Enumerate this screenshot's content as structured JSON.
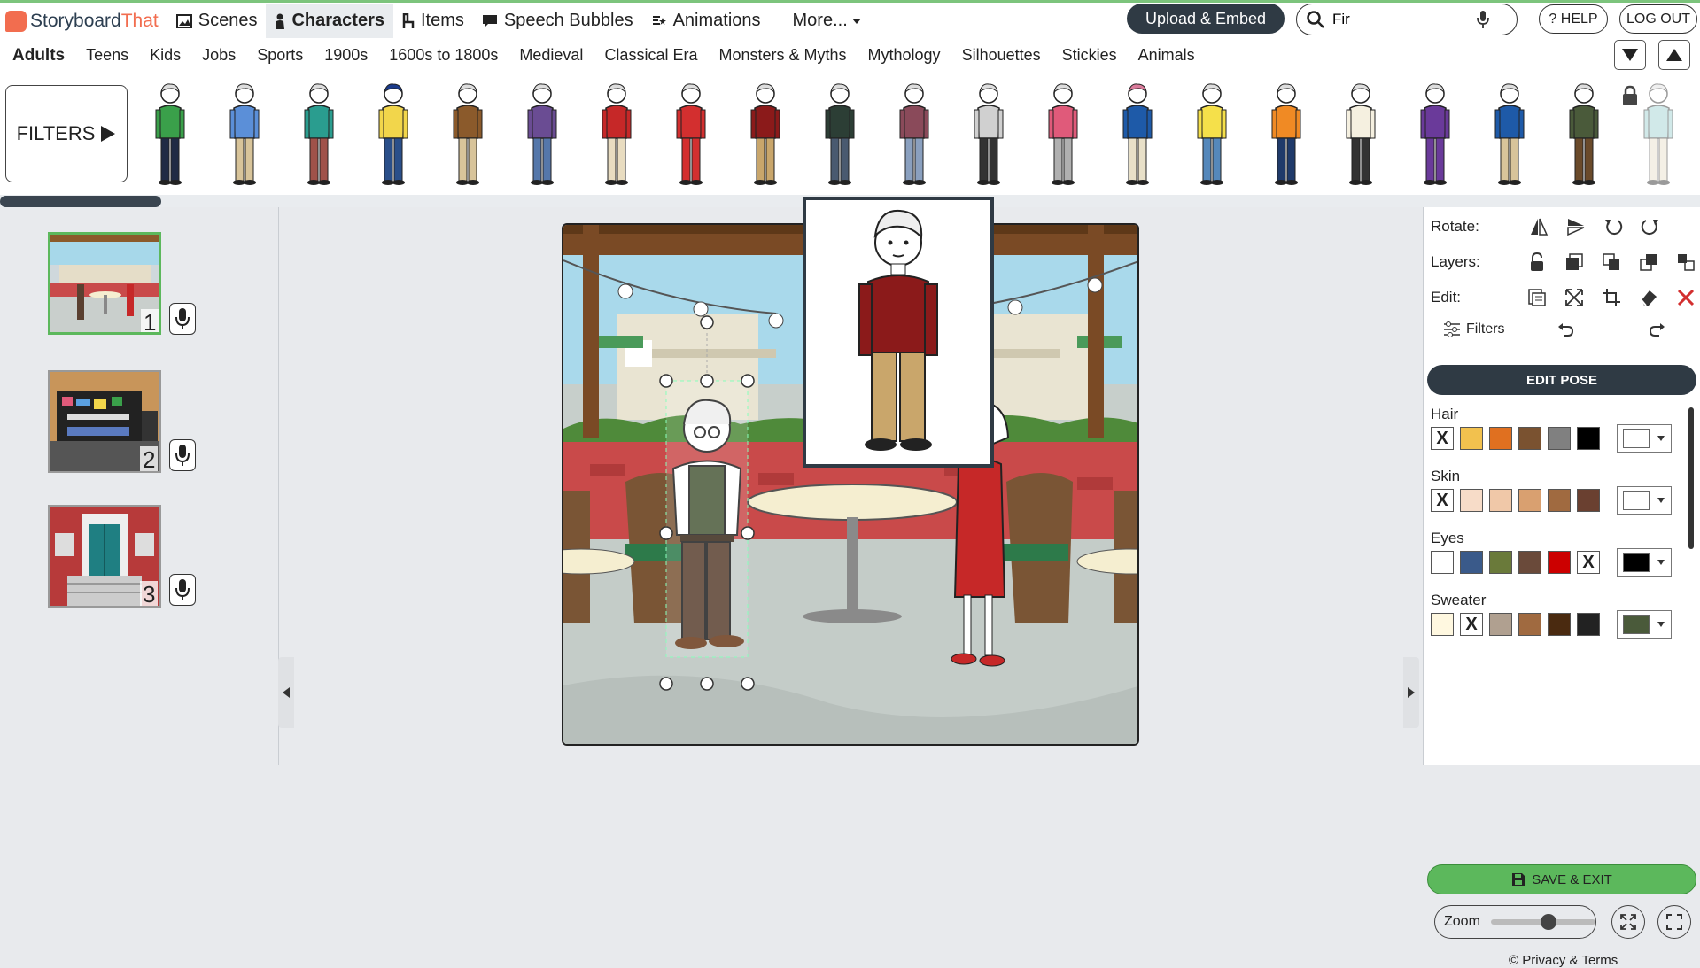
{
  "app": {
    "logo_part1": "Storyboard",
    "logo_part2": "That"
  },
  "nav": {
    "tabs": [
      {
        "label": "Scenes",
        "icon": "image-icon"
      },
      {
        "label": "Characters",
        "icon": "person-icon",
        "active": true
      },
      {
        "label": "Items",
        "icon": "chair-icon"
      },
      {
        "label": "Speech Bubbles",
        "icon": "speech-bubble-icon"
      },
      {
        "label": "Animations",
        "icon": "animations-icon"
      },
      {
        "label": "More...",
        "icon": "chevron-down-icon"
      }
    ],
    "upload_label": "Upload & Embed",
    "search_value": "Fir",
    "help_label": "? HELP",
    "logout_label": "LOG OUT"
  },
  "categories": [
    "Adults",
    "Teens",
    "Kids",
    "Jobs",
    "Sports",
    "1900s",
    "1600s to 1800s",
    "Medieval",
    "Classical Era",
    "Monsters & Myths",
    "Mythology",
    "Silhouettes",
    "Stickies",
    "Animals"
  ],
  "filters_label": "FILTERS",
  "characters": [
    {
      "shirt": "#3aa04a",
      "pants": "#1f2a44",
      "hair": "#ddd"
    },
    {
      "shirt": "#5b8fd8",
      "pants": "#d8c49a",
      "hair": "#ddd"
    },
    {
      "shirt": "#2a9d8f",
      "pants": "#a0524a",
      "hair": "#ddd"
    },
    {
      "shirt": "#f2d64b",
      "pants": "#2a4f8a",
      "hair": "#1a3a8a"
    },
    {
      "shirt": "#8b5a2b",
      "pants": "#d8c49a",
      "hair": "#ddd"
    },
    {
      "shirt": "#6a4c93",
      "pants": "#5577aa",
      "hair": "#ddd"
    },
    {
      "shirt": "#c62828",
      "pants": "#e8dcc0",
      "hair": "#ddd"
    },
    {
      "shirt": "#d32f2f",
      "pants": "#d32f2f",
      "hair": "#ddd"
    },
    {
      "shirt": "#8b1a1a",
      "pants": "#c9a66b",
      "hair": "#ddd"
    },
    {
      "shirt": "#2c3e35",
      "pants": "#4a5a70",
      "hair": "#ddd"
    },
    {
      "shirt": "#8a4a5a",
      "pants": "#8aa0bf",
      "hair": "#ddd"
    },
    {
      "shirt": "#d0d0d0",
      "pants": "#333333",
      "hair": "#ddd"
    },
    {
      "shirt": "#e05a7a",
      "pants": "#b0b0b0",
      "hair": "#ddd"
    },
    {
      "shirt": "#1e5aa8",
      "pants": "#e8e0c8",
      "hair": "#d97a9a"
    },
    {
      "shirt": "#f5e04a",
      "pants": "#5588bb",
      "hair": "#ddd"
    },
    {
      "shirt": "#f08a24",
      "pants": "#1f3a6a",
      "hair": "#ddd"
    },
    {
      "shirt": "#f5f0e0",
      "pants": "#333333",
      "hair": "#ddd"
    },
    {
      "shirt": "#6a3a9a",
      "pants": "#6a3a9a",
      "hair": "#ddd"
    },
    {
      "shirt": "#1e5aa8",
      "pants": "#d8c49a",
      "hair": "#ddd"
    },
    {
      "shirt": "#4a5a3a",
      "pants": "#6a4a2a",
      "hair": "#ddd"
    },
    {
      "shirt": "#9ad0d0",
      "pants": "#e8e0c8",
      "hair": "#ddd"
    }
  ],
  "storyboard": {
    "cells": [
      {
        "number": "1"
      },
      {
        "number": "2"
      },
      {
        "number": "3"
      }
    ]
  },
  "right_panel": {
    "rotate_label": "Rotate:",
    "layers_label": "Layers:",
    "edit_label": "Edit:",
    "filters_label": "Filters",
    "edit_pose_label": "EDIT POSE",
    "color_sections": [
      {
        "label": "Hair",
        "swatches": [
          "X",
          "#f2c14e",
          "#e07020",
          "#7a5230",
          "#808080",
          "#000000"
        ],
        "selected": "#ffffff"
      },
      {
        "label": "Skin",
        "swatches": [
          "X",
          "#f7dcc8",
          "#f0c8a8",
          "#d9a070",
          "#a06a40",
          "#6a4030"
        ],
        "selected": "#ffffff"
      },
      {
        "label": "Eyes",
        "swatches": [
          "#ffffff",
          "#3a5a8a",
          "#6a7a3a",
          "#6a4a3a",
          "#cc0000",
          "X"
        ],
        "selected": "#000000"
      },
      {
        "label": "Sweater",
        "swatches": [
          "#fff8e0",
          "X",
          "#b0a090",
          "#a06a40",
          "#4a2a10",
          "#222222"
        ],
        "selected": "#4a5a3a"
      }
    ],
    "save_exit_label": "SAVE & EXIT",
    "zoom_label": "Zoom",
    "zoom_level": 0.55,
    "privacy_label": "© Privacy & Terms"
  }
}
